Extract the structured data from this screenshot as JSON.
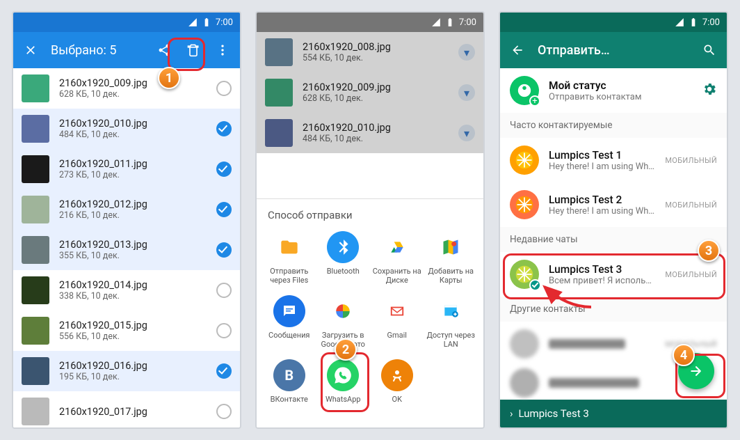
{
  "status_time": "7:00",
  "phone1": {
    "title": "Выбрано: 5",
    "files": [
      {
        "name": "2160x1920_009.jpg",
        "meta": "628 КБ, 10 дек.",
        "selected": false,
        "thumb": "#3aa97b"
      },
      {
        "name": "2160x1920_010.jpg",
        "meta": "484 КБ, 10 дек.",
        "selected": true,
        "thumb": "#5b6da3"
      },
      {
        "name": "2160x1920_011.jpg",
        "meta": "273 КБ, 10 дек.",
        "selected": true,
        "thumb": "#1a1a1a"
      },
      {
        "name": "2160x1920_012.jpg",
        "meta": "216 КБ, 10 дек.",
        "selected": true,
        "thumb": "#9fb49a"
      },
      {
        "name": "2160x1920_013.jpg",
        "meta": "355 КБ, 10 дек.",
        "selected": true,
        "thumb": "#6a7a7d"
      },
      {
        "name": "2160x1920_014.jpg",
        "meta": "338 КБ, 10 дек.",
        "selected": false,
        "thumb": "#273c1a"
      },
      {
        "name": "2160x1920_015.jpg",
        "meta": "556 КБ, 10 дек.",
        "selected": false,
        "thumb": "#5e7e3a"
      },
      {
        "name": "2160x1920_016.jpg",
        "meta": "195 КБ, 10 дек.",
        "selected": true,
        "thumb": "#3b5570"
      },
      {
        "name": "2160x1920_017.jpg",
        "meta": "",
        "selected": false,
        "thumb": "#bababa"
      }
    ]
  },
  "phone2": {
    "dim_files": [
      {
        "name": "2160x1920_008.jpg",
        "meta": "554 КБ, 10 дек.",
        "thumb": "#6a8ba3"
      },
      {
        "name": "2160x1920_009.jpg",
        "meta": "628 КБ, 10 дек.",
        "thumb": "#3aa97b"
      },
      {
        "name": "2160x1920_010.jpg",
        "meta": "484 КБ, 10 дек.",
        "thumb": "#5b6da3"
      }
    ],
    "sheet_title": "Способ отправки",
    "apps": [
      {
        "label": "Отправить через Files",
        "bg": "#fff",
        "glyph": "folder",
        "c": "#f9a825"
      },
      {
        "label": "Bluetooth",
        "bg": "#2196f3",
        "glyph": "bt",
        "c": "#fff"
      },
      {
        "label": "Сохранить на Диске",
        "bg": "#fff",
        "glyph": "drive",
        "c": "#0f9d58"
      },
      {
        "label": "Добавить на Карты",
        "bg": "#fff",
        "glyph": "maps",
        "c": "#4285f4"
      },
      {
        "label": "Сообщения",
        "bg": "#1a73e8",
        "glyph": "msg",
        "c": "#fff"
      },
      {
        "label": "Загрузить в Google Фото",
        "bg": "#fff",
        "glyph": "photos",
        "c": "#ea4335"
      },
      {
        "label": "Gmail",
        "bg": "#fff",
        "glyph": "gmail",
        "c": "#ea4335"
      },
      {
        "label": "Доступ через LAN",
        "bg": "#fff",
        "glyph": "lan",
        "c": "#29b6f6"
      },
      {
        "label": "ВКонтакте",
        "bg": "#4a76a8",
        "glyph": "vk",
        "c": "#fff"
      },
      {
        "label": "WhatsApp",
        "bg": "#25d366",
        "glyph": "wa",
        "c": "#fff"
      },
      {
        "label": "OK",
        "bg": "#ee8208",
        "glyph": "ok",
        "c": "#fff"
      }
    ]
  },
  "phone3": {
    "title": "Отправить…",
    "my_status": {
      "name": "Мой статус",
      "sub": "Отправить контактам"
    },
    "sec_frequent": "Часто контактируемые",
    "sec_recent": "Недавние чаты",
    "sec_other": "Другие контакты",
    "tag": "МОБИЛЬНЫЙ",
    "contacts": [
      {
        "name": "Lumpics Test 1",
        "sub": "Hey there! I am using WhatsApp",
        "av": "#ffa000",
        "ring": "#ffc107"
      },
      {
        "name": "Lumpics Test 2",
        "sub": "Hey there! I am using WhatsApp",
        "av": "#ff7043",
        "ring": "#ff9800"
      },
      {
        "name": "Lumpics Test 3",
        "sub": "Всем привет! Я использую WhatsAp…",
        "av": "#8bc34a",
        "ring": "#cddc39",
        "checked": true
      }
    ],
    "footer": "Lumpics Test 3"
  },
  "badges": {
    "b1": "1",
    "b2": "2",
    "b3": "3",
    "b4": "4"
  }
}
